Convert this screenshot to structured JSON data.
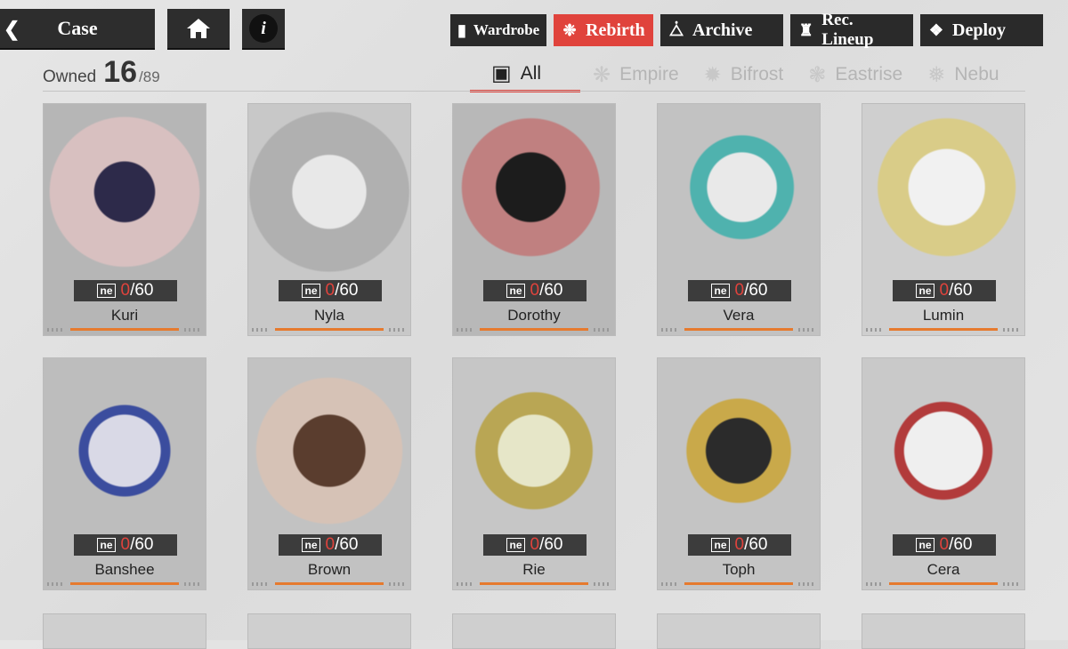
{
  "nav": {
    "case_label": "Case",
    "back_icon": "chevron-left-icon",
    "home_icon": "home-icon",
    "info_label": "i"
  },
  "toolbar": [
    {
      "label": "Wardrobe",
      "icon": "wardrobe-icon",
      "active": false
    },
    {
      "label": "Rebirth",
      "icon": "rebirth-icon",
      "active": true
    },
    {
      "label": "Archive",
      "icon": "archive-icon",
      "active": false
    },
    {
      "label": "Rec. Lineup",
      "icon": "lineup-icon",
      "active": false
    },
    {
      "label": "Deploy",
      "icon": "deploy-icon",
      "active": false
    }
  ],
  "owned": {
    "label": "Owned",
    "count": "16",
    "total": "/89"
  },
  "filters": [
    {
      "label": "All",
      "active": true
    },
    {
      "label": "Empire",
      "active": false
    },
    {
      "label": "Bifrost",
      "active": false
    },
    {
      "label": "Eastrise",
      "active": false
    },
    {
      "label": "Nebu",
      "active": false
    }
  ],
  "colors": {
    "accent": "#e0433c",
    "progress": "#e67a2e",
    "button_dark": "#2a2a2a"
  },
  "cards": [
    {
      "name": "Kuri",
      "current": "0",
      "max": "/60"
    },
    {
      "name": "Nyla",
      "current": "0",
      "max": "/60"
    },
    {
      "name": "Dorothy",
      "current": "0",
      "max": "/60"
    },
    {
      "name": "Vera",
      "current": "0",
      "max": "/60"
    },
    {
      "name": "Lumin",
      "current": "0",
      "max": "/60"
    },
    {
      "name": "Banshee",
      "current": "0",
      "max": "/60"
    },
    {
      "name": "Brown",
      "current": "0",
      "max": "/60"
    },
    {
      "name": "Rie",
      "current": "0",
      "max": "/60"
    },
    {
      "name": "Toph",
      "current": "0",
      "max": "/60"
    },
    {
      "name": "Cera",
      "current": "0",
      "max": "/60"
    }
  ]
}
